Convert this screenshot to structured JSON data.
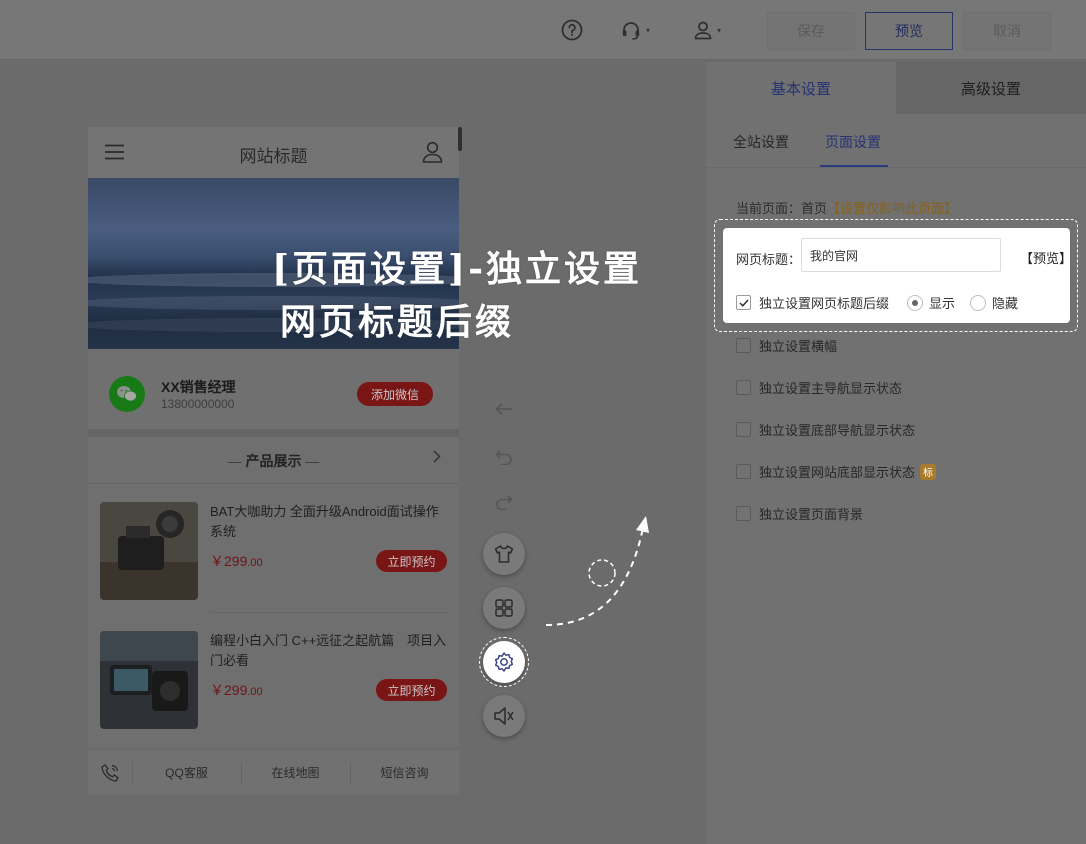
{
  "toolbar": {
    "help_icon": "question-circle-icon",
    "support_icon": "headset-icon",
    "user_icon": "user-icon",
    "caret": "▾",
    "save_label": "保存",
    "preview_label": "预览",
    "cancel_label": "取消"
  },
  "phone": {
    "title": "网站标题",
    "contact": {
      "name": "XX销售经理",
      "phone": "13800000000",
      "button": "添加微信"
    },
    "products_heading": "产品展示",
    "products": [
      {
        "title": "BAT大咖助力 全面升级Android面试操作系统",
        "currency": "￥",
        "price_main": "299",
        "price_cents": ".00",
        "button": "立即预约"
      },
      {
        "title": "编程小白入门 C++远征之起航篇　项目入 门必看",
        "currency": "￥",
        "price_main": "299",
        "price_cents": ".00",
        "button": "立即预约"
      }
    ],
    "footer": [
      "QQ客服",
      "在线地图",
      "短信咨询"
    ]
  },
  "tools": {
    "icons": [
      "back-arrow-icon",
      "undo-icon",
      "redo-icon",
      "shirt-icon",
      "grid-icon",
      "settings-icon",
      "speaker-icon"
    ]
  },
  "overlay": {
    "line1": "[页面设置]-独立设置",
    "line2": "网页标题后缀"
  },
  "panel": {
    "tabs": [
      "基本设置",
      "高级设置"
    ],
    "subtabs": [
      "全站设置",
      "页面设置"
    ],
    "current_page_label": "当前页面：首页",
    "current_page_note": "【设置仅影响此页面】",
    "highlight": {
      "label": "网页标题：",
      "input_value": "我的官网",
      "preview_link": "【预览】",
      "checkbox_label": "独立设置网页标题后缀",
      "radio_show": "显示",
      "radio_hide": "隐藏"
    },
    "options": [
      "独立设置横幅",
      "独立设置主导航显示状态",
      "独立设置底部导航显示状态",
      "独立设置网站底部显示状态",
      "独立设置页面背景"
    ],
    "badge": "标"
  },
  "colors": {
    "accent": "#2b3a7c",
    "danger": "#7a1515",
    "wechat": "#187a16",
    "warn": "#8a6113"
  }
}
